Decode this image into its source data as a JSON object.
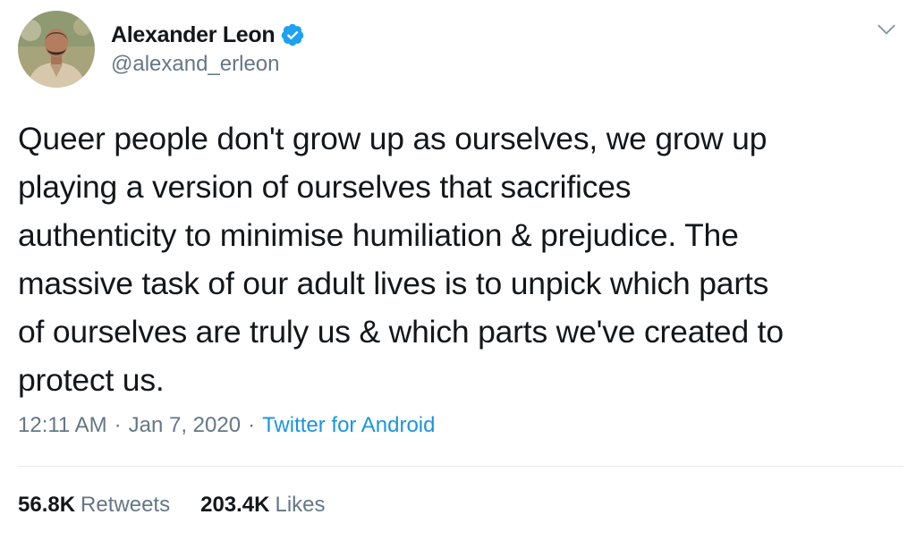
{
  "author": {
    "display_name": "Alexander Leon",
    "handle": "@alexand_erleon",
    "verified": true
  },
  "tweet": {
    "text_lines": [
      "Queer people don't grow up as ourselves, we grow up",
      "playing a version of ourselves that sacrifices",
      "authenticity to minimise humiliation & prejudice. The",
      "massive task of our adult lives is to unpick which parts",
      "of ourselves are truly us & which parts we've created to",
      "protect us."
    ],
    "time": "12:11 AM",
    "separator": "·",
    "date": "Jan 7, 2020",
    "source": "Twitter for Android"
  },
  "stats": {
    "retweets_count": "56.8K",
    "retweets_label": "Retweets",
    "likes_count": "203.4K",
    "likes_label": "Likes"
  },
  "icons": {
    "verified": "verified-badge-icon",
    "menu": "chevron-down-icon"
  },
  "colors": {
    "text": "#14171a",
    "secondary_text": "#657786",
    "link": "#1b95e0",
    "verified_blue": "#1da1f2",
    "divider": "#e6ecf0"
  }
}
